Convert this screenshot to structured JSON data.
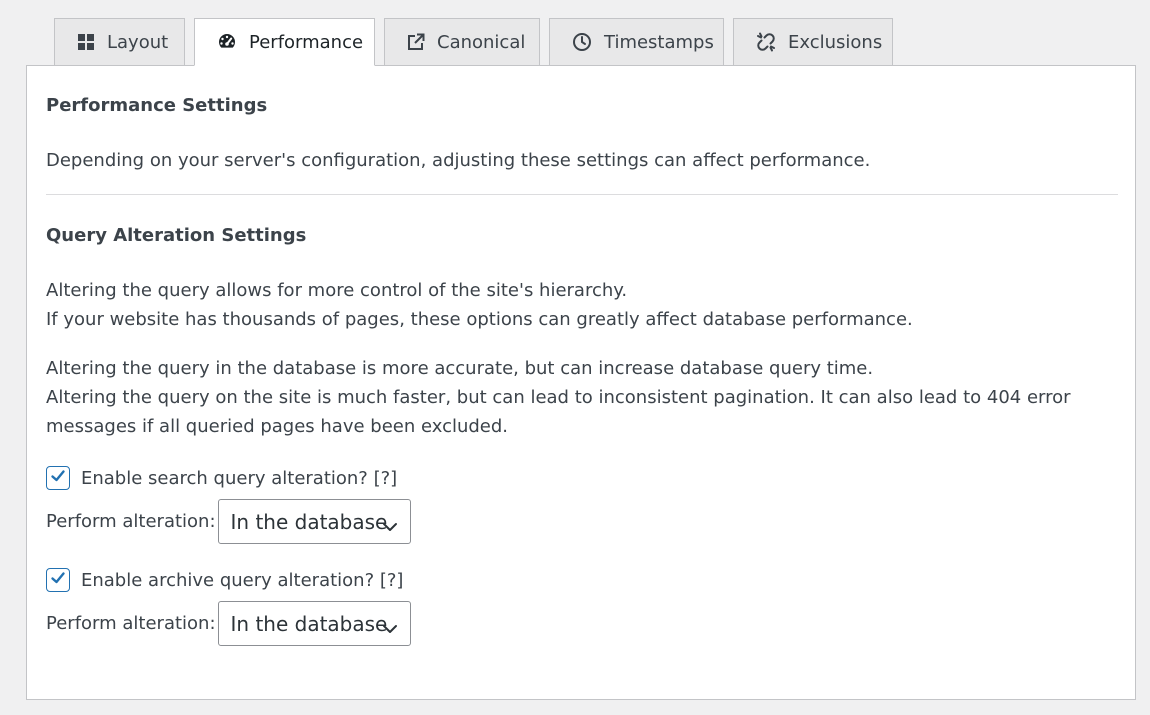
{
  "tabs": [
    {
      "label": "Layout",
      "icon": "grid-icon",
      "active": false
    },
    {
      "label": "Performance",
      "icon": "dashboard-icon",
      "active": true
    },
    {
      "label": "Canonical",
      "icon": "external-link-icon",
      "active": false
    },
    {
      "label": "Timestamps",
      "icon": "clock-icon",
      "active": false
    },
    {
      "label": "Exclusions",
      "icon": "broken-link-icon",
      "active": false
    }
  ],
  "performance": {
    "heading": "Performance Settings",
    "description": "Depending on your server's configuration, adjusting these settings can affect performance."
  },
  "query": {
    "heading": "Query Alteration Settings",
    "p1_line1": "Altering the query allows for more control of the site's hierarchy.",
    "p1_line2": "If your website has thousands of pages, these options can greatly affect database performance.",
    "p2_line1": "Altering the query in the database is more accurate, but can increase database query time.",
    "p2_line2": "Altering the query on the site is much faster, but can lead to inconsistent pagination. It can also lead to 404 error messages if all queried pages have been excluded.",
    "search": {
      "label": "Enable search query alteration? [?]",
      "checked": true,
      "select_label": "Perform alteration:",
      "select_value": "In the database"
    },
    "archive": {
      "label": "Enable archive query alteration? [?]",
      "checked": true,
      "select_label": "Perform alteration:",
      "select_value": "In the database"
    }
  },
  "colors": {
    "accent": "#2271b1",
    "text": "#3c434a",
    "background": "#f0f0f1"
  }
}
